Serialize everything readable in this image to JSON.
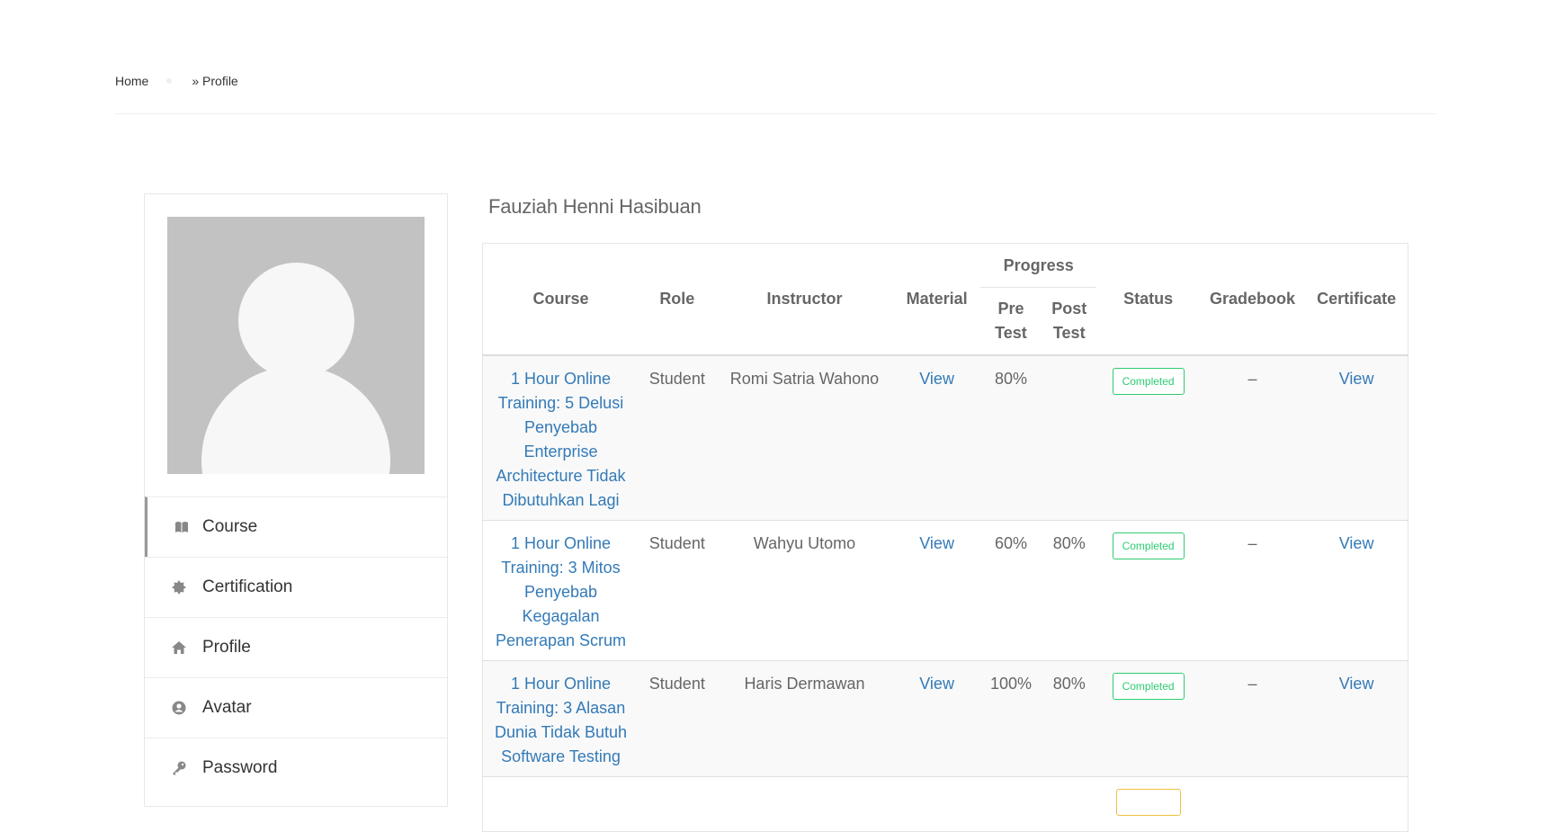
{
  "breadcrumb": {
    "home": "Home",
    "current": "» Profile"
  },
  "profile": {
    "name": "Fauziah Henni Hasibuan"
  },
  "sidebar": {
    "items": [
      {
        "label": "Course",
        "icon": "book-icon",
        "active": true
      },
      {
        "label": "Certification",
        "icon": "certificate-icon",
        "active": false
      },
      {
        "label": "Profile",
        "icon": "home-icon",
        "active": false
      },
      {
        "label": "Avatar",
        "icon": "user-circle-icon",
        "active": false
      },
      {
        "label": "Password",
        "icon": "key-icon",
        "active": false
      }
    ]
  },
  "table": {
    "headers": {
      "course": "Course",
      "role": "Role",
      "instructor": "Instructor",
      "material": "Material",
      "progress": "Progress",
      "pre_test": "Pre Test",
      "post_test": "Post Test",
      "status": "Status",
      "gradebook": "Gradebook",
      "certificate": "Certificate"
    },
    "rows": [
      {
        "course": "1 Hour Online Training: 5 Delusi Penyebab Enterprise Architecture Tidak Dibutuhkan Lagi",
        "role": "Student",
        "instructor": "Romi Satria Wahono",
        "material": "View",
        "pre_test": "80%",
        "post_test": "",
        "status": "Completed",
        "gradebook": "–",
        "certificate": "View"
      },
      {
        "course": "1 Hour Online Training: 3 Mitos Penyebab Kegagalan Penerapan Scrum",
        "role": "Student",
        "instructor": "Wahyu Utomo",
        "material": "View",
        "pre_test": "60%",
        "post_test": "80%",
        "status": "Completed",
        "gradebook": "–",
        "certificate": "View"
      },
      {
        "course": "1 Hour Online Training: 3 Alasan Dunia Tidak Butuh Software Testing",
        "role": "Student",
        "instructor": "Haris Dermawan",
        "material": "View",
        "pre_test": "100%",
        "post_test": "80%",
        "status": "Completed",
        "gradebook": "–",
        "certificate": "View"
      }
    ]
  },
  "colors": {
    "link": "#337ab7",
    "completed": "#2ecc71",
    "pending": "#f0c040"
  }
}
